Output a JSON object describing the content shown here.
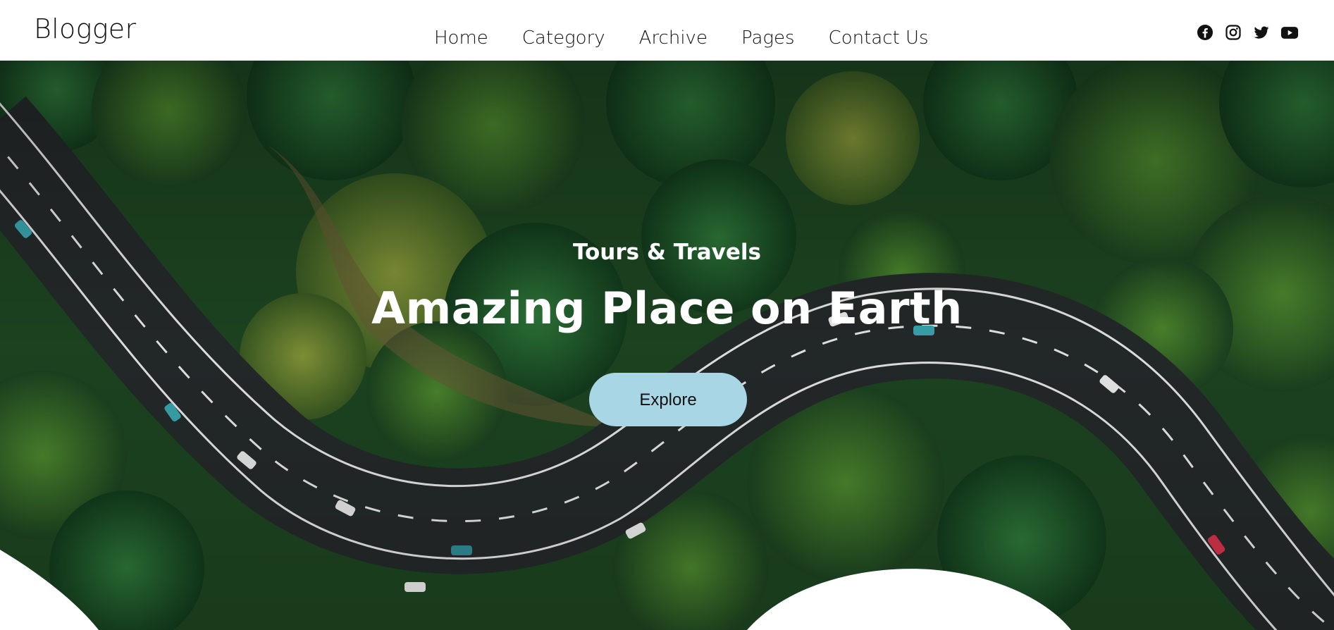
{
  "header": {
    "logo": "Blogger",
    "nav": [
      {
        "label": "Home"
      },
      {
        "label": "Category"
      },
      {
        "label": "Archive"
      },
      {
        "label": "Pages"
      },
      {
        "label": "Contact Us"
      }
    ],
    "social_icons": [
      "facebook-icon",
      "instagram-icon",
      "twitter-icon",
      "youtube-icon"
    ]
  },
  "hero": {
    "subtitle": "Tours & Travels",
    "title": "Amazing Place on Earth",
    "button_label": "Explore"
  },
  "colors": {
    "button_bg": "#a9d6e5",
    "hero_text": "#ffffff",
    "header_bg": "#ffffff",
    "forest": "#1f4a22",
    "road": "#262b2c"
  }
}
